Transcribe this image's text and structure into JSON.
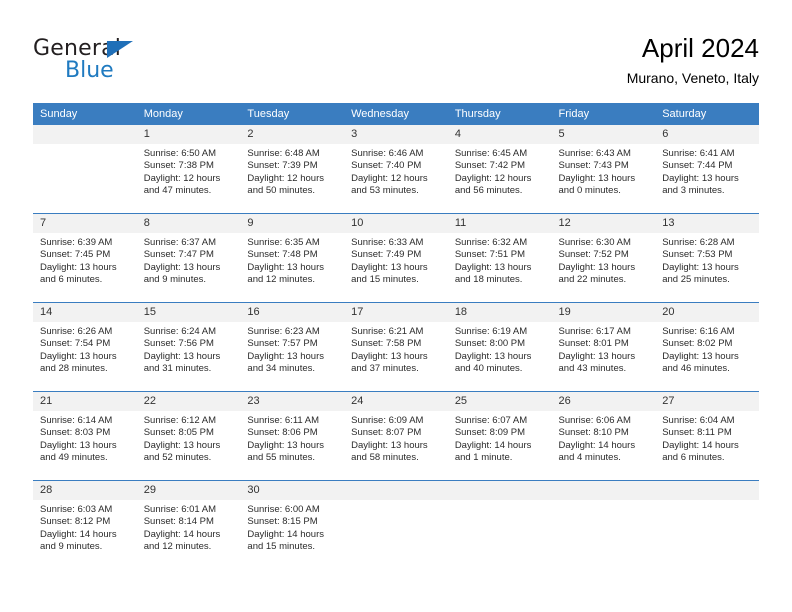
{
  "brand": {
    "name_line1": "General",
    "name_line2": "Blue",
    "triangle_color": "#1f6fb8",
    "blue_color": "#1f7ac0"
  },
  "header": {
    "title": "April 2024",
    "location": "Murano, Veneto, Italy"
  },
  "theme": {
    "header_blue": "#3a7dc0",
    "daynum_bg": "#f2f2f2"
  },
  "weekday_headers": [
    "Sunday",
    "Monday",
    "Tuesday",
    "Wednesday",
    "Thursday",
    "Friday",
    "Saturday"
  ],
  "weeks": [
    [
      {
        "day": "",
        "sunrise": "",
        "sunset": "",
        "daylight1": "",
        "daylight2": "",
        "empty": true
      },
      {
        "day": "1",
        "sunrise": "Sunrise: 6:50 AM",
        "sunset": "Sunset: 7:38 PM",
        "daylight1": "Daylight: 12 hours",
        "daylight2": "and 47 minutes."
      },
      {
        "day": "2",
        "sunrise": "Sunrise: 6:48 AM",
        "sunset": "Sunset: 7:39 PM",
        "daylight1": "Daylight: 12 hours",
        "daylight2": "and 50 minutes."
      },
      {
        "day": "3",
        "sunrise": "Sunrise: 6:46 AM",
        "sunset": "Sunset: 7:40 PM",
        "daylight1": "Daylight: 12 hours",
        "daylight2": "and 53 minutes."
      },
      {
        "day": "4",
        "sunrise": "Sunrise: 6:45 AM",
        "sunset": "Sunset: 7:42 PM",
        "daylight1": "Daylight: 12 hours",
        "daylight2": "and 56 minutes."
      },
      {
        "day": "5",
        "sunrise": "Sunrise: 6:43 AM",
        "sunset": "Sunset: 7:43 PM",
        "daylight1": "Daylight: 13 hours",
        "daylight2": "and 0 minutes."
      },
      {
        "day": "6",
        "sunrise": "Sunrise: 6:41 AM",
        "sunset": "Sunset: 7:44 PM",
        "daylight1": "Daylight: 13 hours",
        "daylight2": "and 3 minutes."
      }
    ],
    [
      {
        "day": "7",
        "sunrise": "Sunrise: 6:39 AM",
        "sunset": "Sunset: 7:45 PM",
        "daylight1": "Daylight: 13 hours",
        "daylight2": "and 6 minutes."
      },
      {
        "day": "8",
        "sunrise": "Sunrise: 6:37 AM",
        "sunset": "Sunset: 7:47 PM",
        "daylight1": "Daylight: 13 hours",
        "daylight2": "and 9 minutes."
      },
      {
        "day": "9",
        "sunrise": "Sunrise: 6:35 AM",
        "sunset": "Sunset: 7:48 PM",
        "daylight1": "Daylight: 13 hours",
        "daylight2": "and 12 minutes."
      },
      {
        "day": "10",
        "sunrise": "Sunrise: 6:33 AM",
        "sunset": "Sunset: 7:49 PM",
        "daylight1": "Daylight: 13 hours",
        "daylight2": "and 15 minutes."
      },
      {
        "day": "11",
        "sunrise": "Sunrise: 6:32 AM",
        "sunset": "Sunset: 7:51 PM",
        "daylight1": "Daylight: 13 hours",
        "daylight2": "and 18 minutes."
      },
      {
        "day": "12",
        "sunrise": "Sunrise: 6:30 AM",
        "sunset": "Sunset: 7:52 PM",
        "daylight1": "Daylight: 13 hours",
        "daylight2": "and 22 minutes."
      },
      {
        "day": "13",
        "sunrise": "Sunrise: 6:28 AM",
        "sunset": "Sunset: 7:53 PM",
        "daylight1": "Daylight: 13 hours",
        "daylight2": "and 25 minutes."
      }
    ],
    [
      {
        "day": "14",
        "sunrise": "Sunrise: 6:26 AM",
        "sunset": "Sunset: 7:54 PM",
        "daylight1": "Daylight: 13 hours",
        "daylight2": "and 28 minutes."
      },
      {
        "day": "15",
        "sunrise": "Sunrise: 6:24 AM",
        "sunset": "Sunset: 7:56 PM",
        "daylight1": "Daylight: 13 hours",
        "daylight2": "and 31 minutes."
      },
      {
        "day": "16",
        "sunrise": "Sunrise: 6:23 AM",
        "sunset": "Sunset: 7:57 PM",
        "daylight1": "Daylight: 13 hours",
        "daylight2": "and 34 minutes."
      },
      {
        "day": "17",
        "sunrise": "Sunrise: 6:21 AM",
        "sunset": "Sunset: 7:58 PM",
        "daylight1": "Daylight: 13 hours",
        "daylight2": "and 37 minutes."
      },
      {
        "day": "18",
        "sunrise": "Sunrise: 6:19 AM",
        "sunset": "Sunset: 8:00 PM",
        "daylight1": "Daylight: 13 hours",
        "daylight2": "and 40 minutes."
      },
      {
        "day": "19",
        "sunrise": "Sunrise: 6:17 AM",
        "sunset": "Sunset: 8:01 PM",
        "daylight1": "Daylight: 13 hours",
        "daylight2": "and 43 minutes."
      },
      {
        "day": "20",
        "sunrise": "Sunrise: 6:16 AM",
        "sunset": "Sunset: 8:02 PM",
        "daylight1": "Daylight: 13 hours",
        "daylight2": "and 46 minutes."
      }
    ],
    [
      {
        "day": "21",
        "sunrise": "Sunrise: 6:14 AM",
        "sunset": "Sunset: 8:03 PM",
        "daylight1": "Daylight: 13 hours",
        "daylight2": "and 49 minutes."
      },
      {
        "day": "22",
        "sunrise": "Sunrise: 6:12 AM",
        "sunset": "Sunset: 8:05 PM",
        "daylight1": "Daylight: 13 hours",
        "daylight2": "and 52 minutes."
      },
      {
        "day": "23",
        "sunrise": "Sunrise: 6:11 AM",
        "sunset": "Sunset: 8:06 PM",
        "daylight1": "Daylight: 13 hours",
        "daylight2": "and 55 minutes."
      },
      {
        "day": "24",
        "sunrise": "Sunrise: 6:09 AM",
        "sunset": "Sunset: 8:07 PM",
        "daylight1": "Daylight: 13 hours",
        "daylight2": "and 58 minutes."
      },
      {
        "day": "25",
        "sunrise": "Sunrise: 6:07 AM",
        "sunset": "Sunset: 8:09 PM",
        "daylight1": "Daylight: 14 hours",
        "daylight2": "and 1 minute."
      },
      {
        "day": "26",
        "sunrise": "Sunrise: 6:06 AM",
        "sunset": "Sunset: 8:10 PM",
        "daylight1": "Daylight: 14 hours",
        "daylight2": "and 4 minutes."
      },
      {
        "day": "27",
        "sunrise": "Sunrise: 6:04 AM",
        "sunset": "Sunset: 8:11 PM",
        "daylight1": "Daylight: 14 hours",
        "daylight2": "and 6 minutes."
      }
    ],
    [
      {
        "day": "28",
        "sunrise": "Sunrise: 6:03 AM",
        "sunset": "Sunset: 8:12 PM",
        "daylight1": "Daylight: 14 hours",
        "daylight2": "and 9 minutes."
      },
      {
        "day": "29",
        "sunrise": "Sunrise: 6:01 AM",
        "sunset": "Sunset: 8:14 PM",
        "daylight1": "Daylight: 14 hours",
        "daylight2": "and 12 minutes."
      },
      {
        "day": "30",
        "sunrise": "Sunrise: 6:00 AM",
        "sunset": "Sunset: 8:15 PM",
        "daylight1": "Daylight: 14 hours",
        "daylight2": "and 15 minutes."
      },
      {
        "day": "",
        "sunrise": "",
        "sunset": "",
        "daylight1": "",
        "daylight2": "",
        "empty": true
      },
      {
        "day": "",
        "sunrise": "",
        "sunset": "",
        "daylight1": "",
        "daylight2": "",
        "empty": true
      },
      {
        "day": "",
        "sunrise": "",
        "sunset": "",
        "daylight1": "",
        "daylight2": "",
        "empty": true
      },
      {
        "day": "",
        "sunrise": "",
        "sunset": "",
        "daylight1": "",
        "daylight2": "",
        "empty": true
      }
    ]
  ]
}
